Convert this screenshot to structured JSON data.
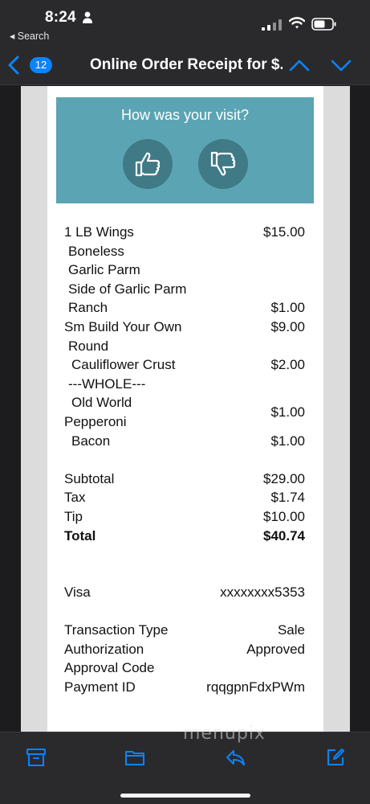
{
  "status_bar": {
    "time": "8:24",
    "back_app": "◂ Search"
  },
  "nav": {
    "badge_count": "12",
    "title": "Online Order Receipt for $..."
  },
  "feedback": {
    "prompt": "How was your visit?"
  },
  "receipt": {
    "items": [
      {
        "label": "1 LB Wings",
        "amount": "$15.00",
        "indent": 0
      },
      {
        "label": "Boneless",
        "amount": "",
        "indent": 1
      },
      {
        "label": "Garlic Parm",
        "amount": "",
        "indent": 1
      },
      {
        "label": "Side of Garlic Parm",
        "amount": "",
        "indent": 1
      },
      {
        "label": "Ranch",
        "amount": "$1.00",
        "indent": 1
      },
      {
        "label": "Sm Build Your Own",
        "amount": "$9.00",
        "indent": 0
      },
      {
        "label": "Round",
        "amount": "",
        "indent": 1
      },
      {
        "label": "Cauliflower Crust",
        "amount": "$2.00",
        "indent": 2
      },
      {
        "label": "---WHOLE---",
        "amount": "",
        "indent": 1
      },
      {
        "label": "Old World",
        "amount": "",
        "indent": 2
      },
      {
        "label": "Pepperoni",
        "amount": "$1.00",
        "indent": 0
      },
      {
        "label": "Bacon",
        "amount": "$1.00",
        "indent": 2
      }
    ],
    "totals": [
      {
        "label": "Subtotal",
        "amount": "$29.00",
        "bold": false
      },
      {
        "label": "Tax",
        "amount": "$1.74",
        "bold": false
      },
      {
        "label": "Tip",
        "amount": "$10.00",
        "bold": false
      },
      {
        "label": "Total",
        "amount": "$40.74",
        "bold": true
      }
    ],
    "payment": {
      "label": "Visa",
      "value": "xxxxxxxx5353"
    },
    "transaction": [
      {
        "label": "Transaction Type",
        "value": "Sale"
      },
      {
        "label": "Authorization",
        "value": "Approved"
      },
      {
        "label": "Approval Code",
        "value": ""
      },
      {
        "label": "Payment ID",
        "value": "rqqgpnFdxPWm"
      }
    ]
  },
  "watermark": "menupix",
  "colors": {
    "accent": "#0a84ff",
    "feedback_panel": "#5aa4b4",
    "thumb_button": "#3f7a86"
  },
  "icons": {
    "toolbar": [
      "archive-icon",
      "folder-icon",
      "reply-icon",
      "compose-icon"
    ]
  }
}
